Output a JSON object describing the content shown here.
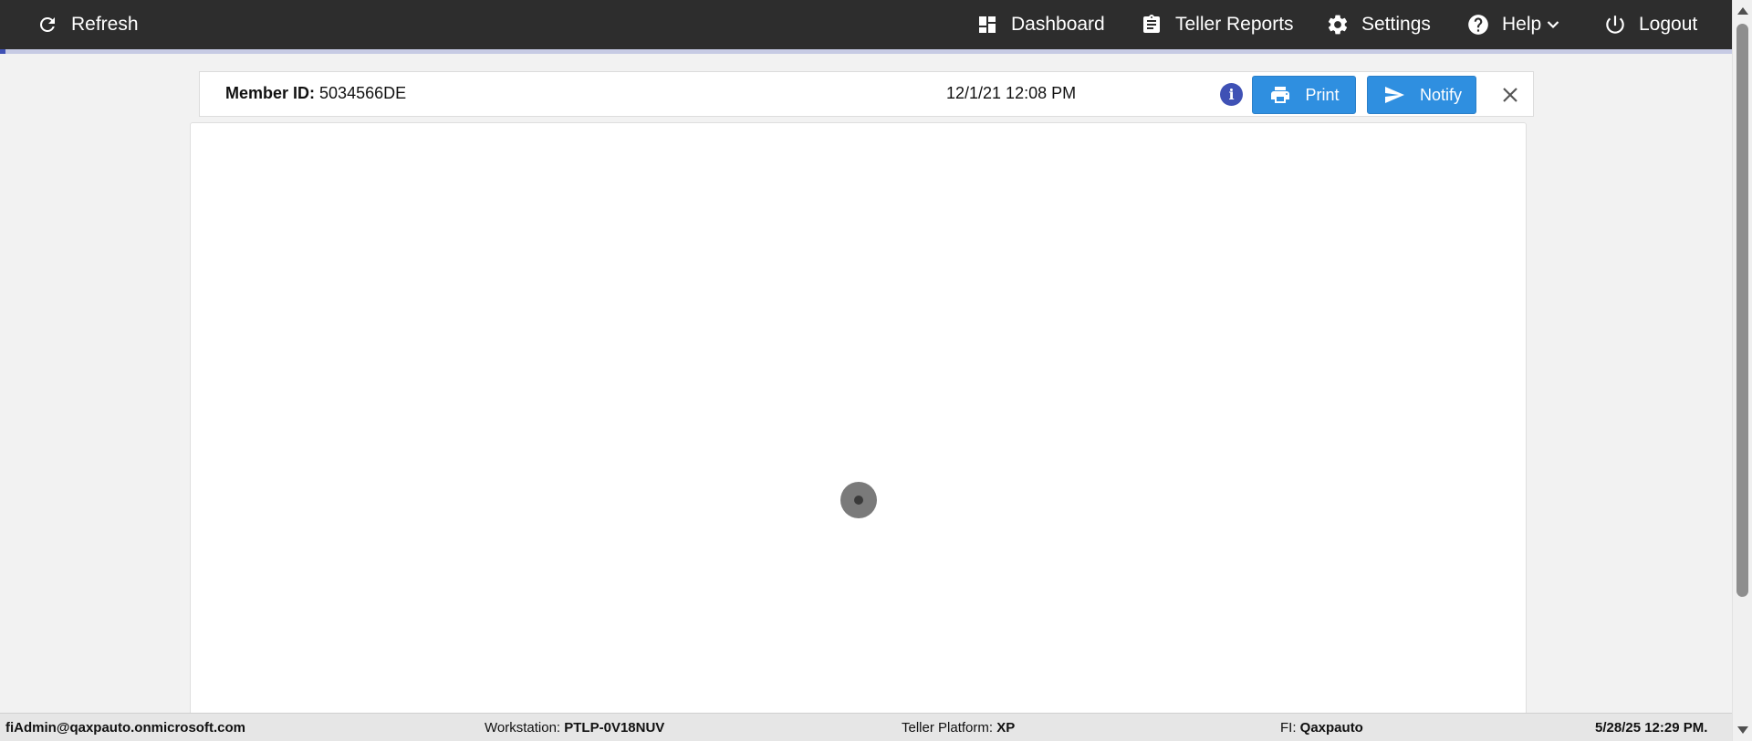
{
  "nav": {
    "refresh": "Refresh",
    "dashboard": "Dashboard",
    "teller_reports": "Teller Reports",
    "settings": "Settings",
    "help": "Help",
    "logout": "Logout"
  },
  "member": {
    "id_label": "Member ID:",
    "id_value": "5034566DE",
    "datetime": "12/1/21 12:08 PM",
    "info_icon": "i",
    "print_label": "Print",
    "notify_label": "Notify"
  },
  "footer": {
    "user": "fiAdmin@qaxpauto.onmicrosoft.com",
    "workstation_label": "Workstation:",
    "workstation_value": "PTLP-0V18NUV",
    "platform_label": "Teller Platform:",
    "platform_value": "XP",
    "fi_label": "FI:",
    "fi_value": "Qaxpauto",
    "timestamp": "5/28/25 12:29 PM."
  },
  "icons": {
    "refresh": "refresh-icon",
    "dashboard": "dashboard-icon",
    "reports": "clipboard-icon",
    "settings": "gear-icon",
    "help": "help-icon",
    "logout": "power-icon",
    "print": "printer-icon",
    "notify": "send-icon",
    "close": "close-icon",
    "info": "info-icon"
  },
  "colors": {
    "nav_bg": "#2d2d2d",
    "button_blue": "#2f8fe0",
    "info_blue": "#3f51b5"
  }
}
